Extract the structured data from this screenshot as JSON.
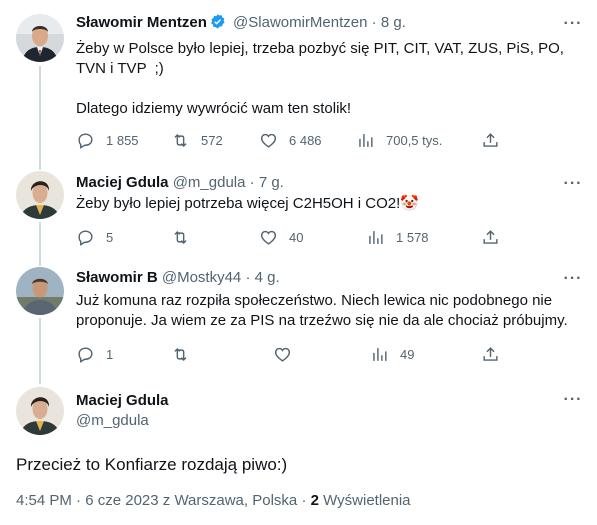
{
  "tweets": [
    {
      "name": "Sławomir Mentzen",
      "handle": "@SlawomirMentzen",
      "separator": "·",
      "time": "8 g.",
      "text": "Żeby w Polsce było lepiej, trzeba pozbyć się PIT, CIT, VAT, ZUS, PiS, PO, TVN i TVP  ;)\n\nDlatego idziemy wywrócić wam ten stolik!",
      "replies": "1 855",
      "retweets": "572",
      "likes": "6 486",
      "views": "700,5 tys."
    },
    {
      "name": "Maciej Gdula",
      "handle": "@m_gdula",
      "separator": "·",
      "time": "7 g.",
      "text": "Żeby było lepiej potrzeba więcej C2H5OH i CO2!🤡",
      "replies": "5",
      "retweets": "",
      "likes": "40",
      "views": "1 578"
    },
    {
      "name": "Sławomir B",
      "handle": "@Mostky44",
      "separator": "·",
      "time": "4 g.",
      "text": "Już komuna raz rozpiła społeczeństwo. Niech lewica nic podobnego nie proponuje. Ja wiem ze za PIS na trzeźwo się nie da ale chociaż próbujmy.",
      "replies": "1",
      "retweets": "",
      "likes": "",
      "views": "49"
    }
  ],
  "main": {
    "name": "Maciej Gdula",
    "handle": "@m_gdula",
    "text": "Przecież to Konfiarze rozdają piwo:)",
    "time": "4:54 PM",
    "date": "6 cze 2023 z Warszawa, Polska",
    "separator": "·",
    "views_count": "2",
    "views_label": "Wyświetlenia"
  },
  "icons": {
    "more": "more-dots-icon",
    "reply": "reply-icon",
    "retweet": "retweet-icon",
    "like": "heart-icon",
    "views": "views-chart-icon",
    "share": "share-icon",
    "verified": "verified-badge-icon"
  },
  "colors": {
    "verified": "#1d9bf0",
    "text": "#0f1419",
    "muted": "#536471",
    "line": "#cfd9de"
  }
}
